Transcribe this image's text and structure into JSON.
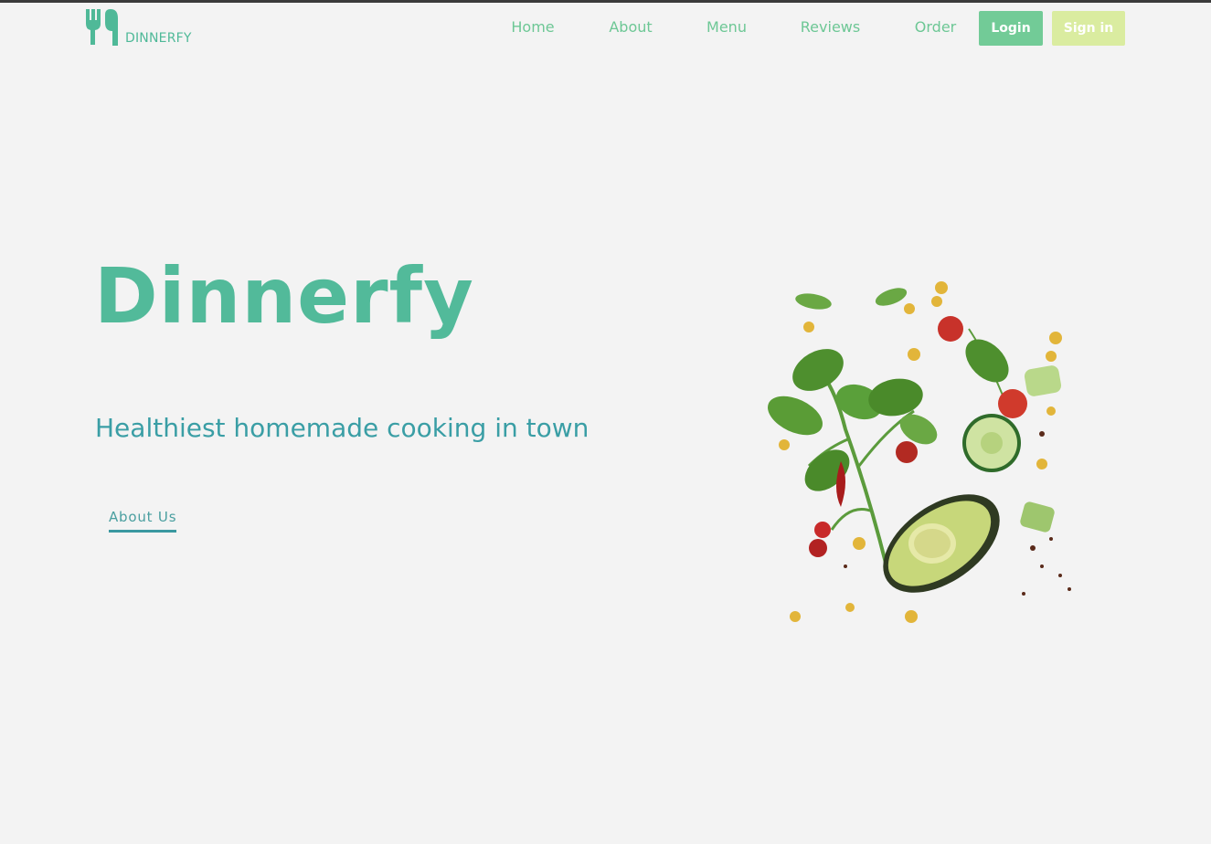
{
  "brand": {
    "name": "DINNERFY",
    "logo_icon": "fork-knife-icon",
    "color": "#4fb998"
  },
  "nav": {
    "links": [
      "Home",
      "About",
      "Menu",
      "Reviews",
      "Order"
    ],
    "login_label": "Login",
    "signin_label": "Sign in"
  },
  "hero": {
    "title": "Dinnerfy",
    "subtitle": "Healthiest homemade cooking in town",
    "cta_label": "About Us",
    "image_icon": "salad-ingredients-image"
  },
  "colors": {
    "background": "#f3f3f3",
    "primary": "#52ba9a",
    "nav_text": "#6dc795",
    "login_bg": "#72cb97",
    "signin_bg": "#daeca0",
    "subtitle": "#3a9ea5"
  }
}
